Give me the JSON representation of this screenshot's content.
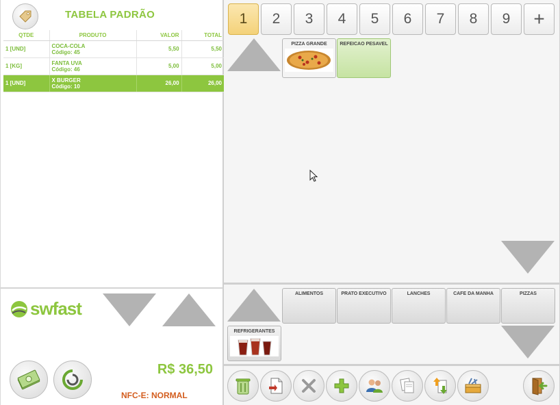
{
  "header": {
    "title": "TABELA PADRÃO"
  },
  "order": {
    "columns": [
      "QTDE",
      "PRODUTO",
      "VALOR",
      "TOTAL"
    ],
    "rows": [
      {
        "qty": "1 [UND]",
        "name": "COCA-COLA",
        "code": "Código: 45",
        "value": "5,50",
        "total": "5,50",
        "selected": false
      },
      {
        "qty": "1 [KG]",
        "name": "FANTA UVA",
        "code": "Código: 46",
        "value": "5,00",
        "total": "5,00",
        "selected": false
      },
      {
        "qty": "1 [UND]",
        "name": "X BURGER",
        "code": "Código: 10",
        "value": "26,00",
        "total": "26,00",
        "selected": true
      }
    ]
  },
  "footer": {
    "logo_text": "swfast",
    "total": "R$ 36,50",
    "nfce_status": "NFC-E: NORMAL"
  },
  "pages": {
    "tabs": [
      "1",
      "2",
      "3",
      "4",
      "5",
      "6",
      "7",
      "8",
      "9"
    ],
    "active": "1",
    "add_label": "+"
  },
  "products": [
    {
      "label": "PIZZA GRANDE",
      "image": "pizza-image",
      "style": "plain"
    },
    {
      "label": "REFEICAO PESAVEL",
      "image": "",
      "style": "green"
    }
  ],
  "categories": [
    {
      "label": "ALIMENTOS",
      "image": ""
    },
    {
      "label": "PRATO EXECUTIVO",
      "image": ""
    },
    {
      "label": "LANCHES",
      "image": ""
    },
    {
      "label": "CAFE DA MANHA",
      "image": ""
    },
    {
      "label": "PIZZAS",
      "image": ""
    },
    {
      "label": "REFRIGERANTES",
      "image": "drinks-image"
    }
  ],
  "toolbar": {
    "icons": [
      "trash-icon",
      "document-icon",
      "cancel-cross-icon",
      "add-icon",
      "customers-icon",
      "copy-pages-icon",
      "transfer-icon",
      "toolbox-icon",
      "exit-door-icon"
    ]
  },
  "colors": {
    "accent_green": "#8dc63f",
    "status_orange": "#d35d1e",
    "active_tab": "#f4d27a"
  }
}
